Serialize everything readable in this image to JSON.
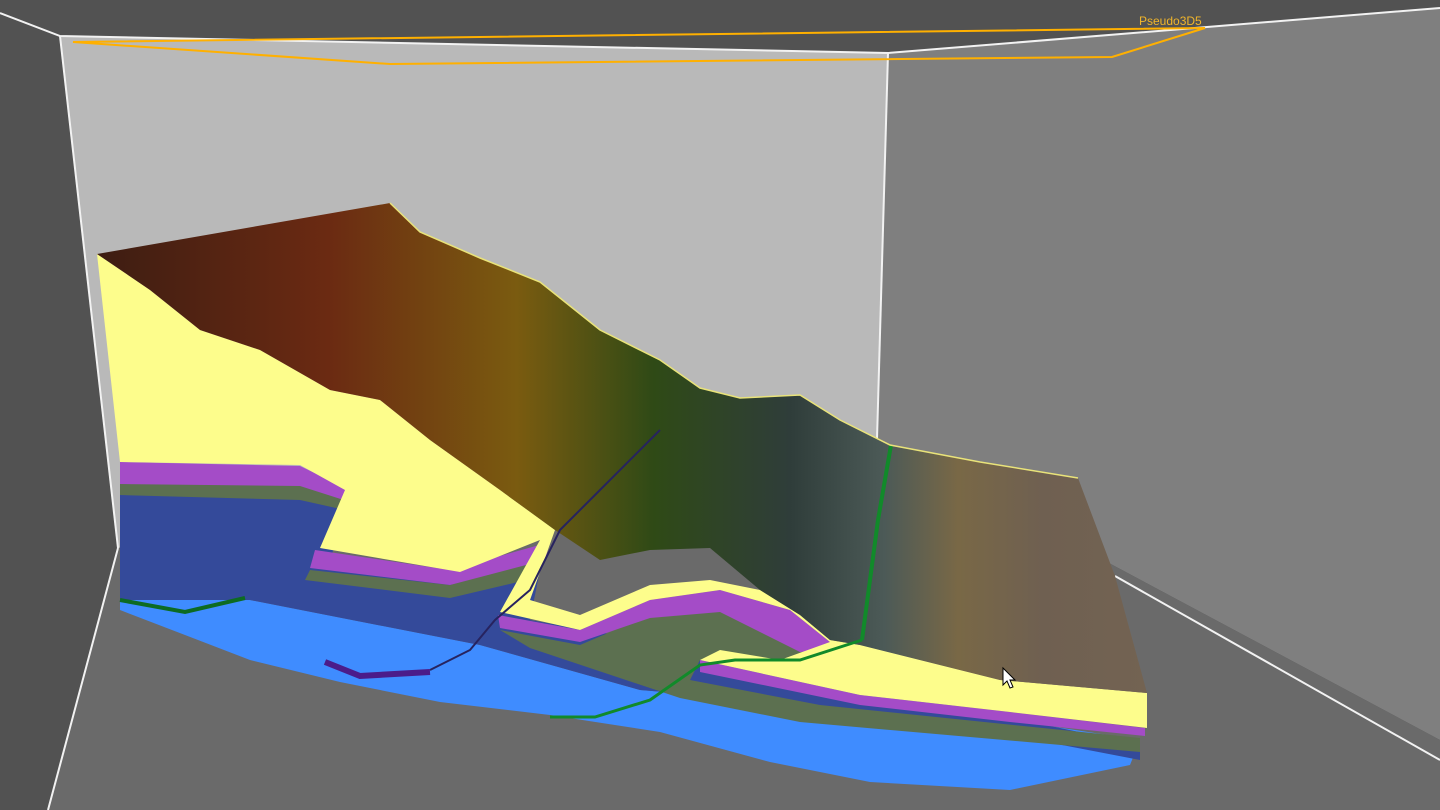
{
  "viewport": {
    "label": "Pseudo3D5",
    "label_color": "#f1b52a",
    "cursor_icon": "arrow-cursor-icon"
  },
  "colors": {
    "room_outer": "#525252",
    "back_wall": "#b9b9b9",
    "right_wall": "#7f7f7f",
    "floor": "#6a6a6a",
    "wall_line": "#f2f2f2",
    "selection": "#ffb000",
    "layer_blue": "#3f8cff",
    "layer_dark_blue": "#344a9a",
    "layer_olive": "#5c7050",
    "layer_purple": "#a44cc7",
    "layer_yellow": "#fdfd8c",
    "layer_brown": "#6e5f52"
  }
}
